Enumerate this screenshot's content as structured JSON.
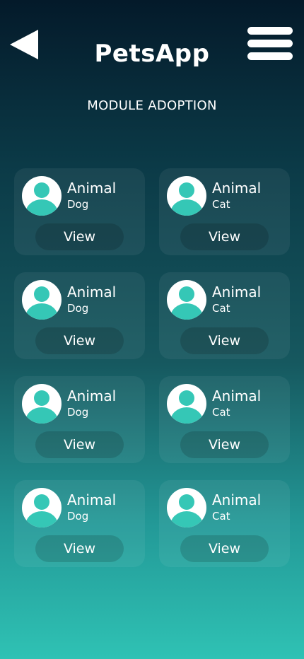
{
  "header": {
    "title": "PetsApp",
    "subtitle": "MODULE ADOPTION",
    "back_icon": "back-arrow-icon",
    "menu_icon": "hamburger-menu-icon"
  },
  "colors": {
    "accent": "#35c7b6",
    "background_top": "#041a2a",
    "background_bottom": "#2fc2b4"
  },
  "cards": [
    {
      "title": "Animal",
      "type": "Dog",
      "button": "View"
    },
    {
      "title": "Animal",
      "type": "Cat",
      "button": "View"
    },
    {
      "title": "Animal",
      "type": "Dog",
      "button": "View"
    },
    {
      "title": "Animal",
      "type": "Cat",
      "button": "View"
    },
    {
      "title": "Animal",
      "type": "Dog",
      "button": "View"
    },
    {
      "title": "Animal",
      "type": "Cat",
      "button": "View"
    },
    {
      "title": "Animal",
      "type": "Dog",
      "button": "View"
    },
    {
      "title": "Animal",
      "type": "Cat",
      "button": "View"
    }
  ]
}
